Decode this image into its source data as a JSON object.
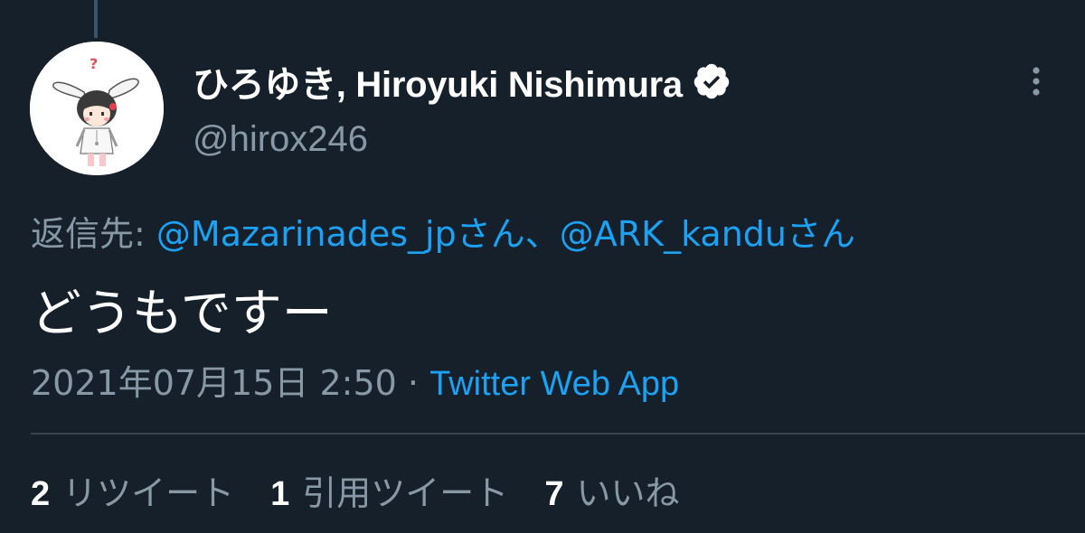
{
  "tweet": {
    "author": {
      "display_name": "ひろゆき, Hiroyuki Nishimura",
      "handle": "@hirox246",
      "verified": true,
      "avatar_icon": "avatar-bunny-ears-character"
    },
    "reply_to": {
      "prefix": "返信先:",
      "mentions": [
        {
          "name": "@Mazarinades_jpさん"
        },
        {
          "name": "@ARK_kanduさん"
        }
      ],
      "separator": "、"
    },
    "text": "どうもですー",
    "timestamp": "2021年07月15日 2:50",
    "dot": "·",
    "source": "Twitter Web App",
    "stats": [
      {
        "count": "2",
        "label": "リツイート"
      },
      {
        "count": "1",
        "label": "引用ツイート"
      },
      {
        "count": "7",
        "label": "いいね"
      }
    ]
  },
  "colors": {
    "background": "#15202b",
    "primary_text": "#ffffff",
    "secondary_text": "#8899a6",
    "link": "#1da1f2",
    "divider": "#38444d"
  },
  "icons": {
    "verified": "verified-badge-icon",
    "more": "more-vertical-icon"
  }
}
